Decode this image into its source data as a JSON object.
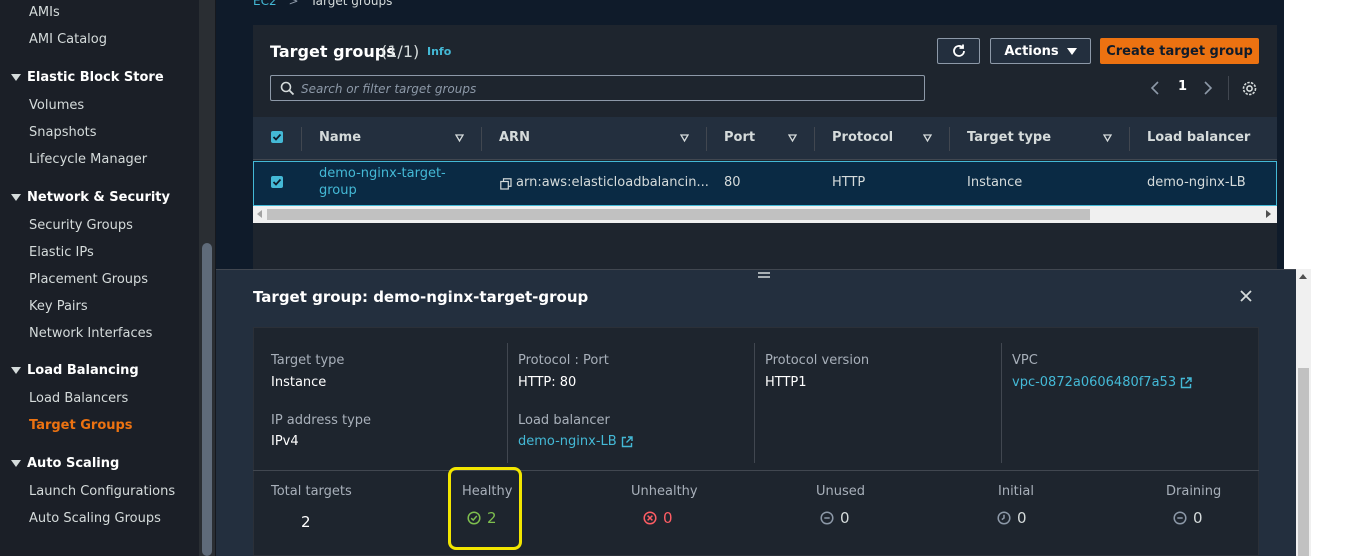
{
  "sidebar": {
    "items": [
      {
        "label": "AMIs",
        "type": "item"
      },
      {
        "label": "AMI Catalog",
        "type": "item"
      },
      {
        "label": "Elastic Block Store",
        "type": "head"
      },
      {
        "label": "Volumes",
        "type": "item"
      },
      {
        "label": "Snapshots",
        "type": "item"
      },
      {
        "label": "Lifecycle Manager",
        "type": "item"
      },
      {
        "label": "Network & Security",
        "type": "head"
      },
      {
        "label": "Security Groups",
        "type": "item"
      },
      {
        "label": "Elastic IPs",
        "type": "item"
      },
      {
        "label": "Placement Groups",
        "type": "item"
      },
      {
        "label": "Key Pairs",
        "type": "item"
      },
      {
        "label": "Network Interfaces",
        "type": "item"
      },
      {
        "label": "Load Balancing",
        "type": "head"
      },
      {
        "label": "Load Balancers",
        "type": "item"
      },
      {
        "label": "Target Groups",
        "type": "item",
        "active": true
      },
      {
        "label": "Auto Scaling",
        "type": "head"
      },
      {
        "label": "Launch Configurations",
        "type": "item"
      },
      {
        "label": "Auto Scaling Groups",
        "type": "item"
      }
    ]
  },
  "breadcrumb": {
    "root": "EC2",
    "sep": ">",
    "current": "Target groups"
  },
  "header": {
    "title": "Target groups",
    "count": "(1/1)",
    "info": "Info",
    "actions_label": "Actions",
    "create_label": "Create target group"
  },
  "search": {
    "placeholder": "Search or filter target groups"
  },
  "pagination": {
    "page": "1"
  },
  "table": {
    "columns": [
      "Name",
      "ARN",
      "Port",
      "Protocol",
      "Target type",
      "Load balancer"
    ],
    "rows": [
      {
        "name_line1": "demo-nginx-target-",
        "name_line2": "group",
        "arn": "arn:aws:elasticloadbalancin...",
        "port": "80",
        "protocol": "HTTP",
        "target_type": "Instance",
        "load_balancer": "demo-nginx-LB",
        "selected": true
      }
    ]
  },
  "details": {
    "title": "Target group: demo-nginx-target-group",
    "target_type_label": "Target type",
    "target_type": "Instance",
    "protocol_port_label": "Protocol : Port",
    "protocol_port": "HTTP: 80",
    "protocol_version_label": "Protocol version",
    "protocol_version": "HTTP1",
    "vpc_label": "VPC",
    "vpc": "vpc-0872a0606480f7a53",
    "ip_type_label": "IP address type",
    "ip_type": "IPv4",
    "lb_label": "Load balancer",
    "lb": "demo-nginx-LB"
  },
  "stats": {
    "total_label": "Total targets",
    "total": "2",
    "healthy_label": "Healthy",
    "healthy": "2",
    "unhealthy_label": "Unhealthy",
    "unhealthy": "0",
    "unused_label": "Unused",
    "unused": "0",
    "initial_label": "Initial",
    "initial": "0",
    "draining_label": "Draining",
    "draining": "0"
  },
  "colors": {
    "accent": "#ec7211",
    "link": "#44b9d6",
    "healthy": "#7ebf4e",
    "unhealthy": "#ff5d64",
    "highlight": "#f2e600"
  }
}
